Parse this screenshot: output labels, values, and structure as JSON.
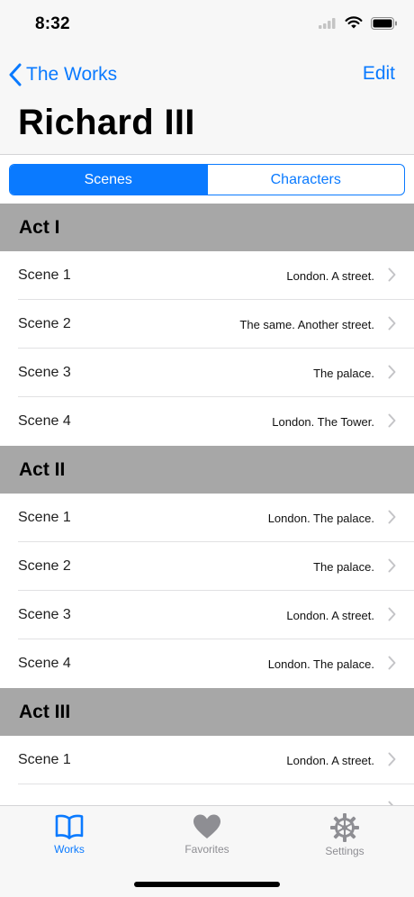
{
  "status_bar": {
    "time": "8:32"
  },
  "nav": {
    "back_label": "The Works",
    "edit_label": "Edit",
    "title": "Richard III"
  },
  "segments": [
    {
      "label": "Scenes",
      "selected": true
    },
    {
      "label": "Characters",
      "selected": false
    }
  ],
  "acts": [
    {
      "title": "Act I",
      "scenes": [
        {
          "title": "Scene 1",
          "location": "London. A street."
        },
        {
          "title": "Scene 2",
          "location": "The same. Another street."
        },
        {
          "title": "Scene 3",
          "location": "The palace."
        },
        {
          "title": "Scene 4",
          "location": "London. The Tower."
        }
      ]
    },
    {
      "title": "Act II",
      "scenes": [
        {
          "title": "Scene 1",
          "location": "London. The palace."
        },
        {
          "title": "Scene 2",
          "location": "The palace."
        },
        {
          "title": "Scene 3",
          "location": "London. A street."
        },
        {
          "title": "Scene 4",
          "location": "London. The palace."
        }
      ]
    },
    {
      "title": "Act III",
      "scenes": [
        {
          "title": "Scene 1",
          "location": "London. A street."
        }
      ]
    }
  ],
  "tabs": [
    {
      "label": "Works",
      "icon": "book-icon",
      "active": true
    },
    {
      "label": "Favorites",
      "icon": "heart-icon",
      "active": false
    },
    {
      "label": "Settings",
      "icon": "gear-icon",
      "active": false
    }
  ],
  "colors": {
    "accent": "#0a7aff",
    "section_header": "#a7a7a7",
    "inactive_tab": "#8e8e93"
  }
}
